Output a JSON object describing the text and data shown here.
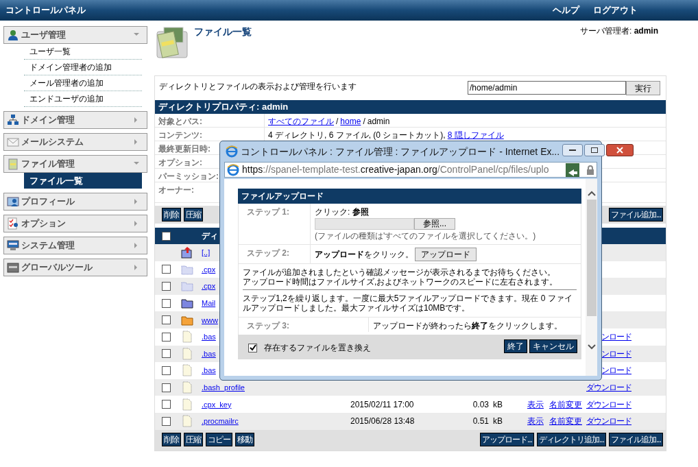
{
  "topbar": {
    "title": "コントロールパネル",
    "links": [
      "ヘルプ",
      "ログアウト"
    ]
  },
  "sidebar": [
    {
      "label": "ユーザ管理",
      "expanded": true,
      "children": [
        {
          "label": "ユーザ一覧",
          "selected": false
        },
        {
          "label": "ドメイン管理者の追加",
          "selected": false
        },
        {
          "label": "メール管理者の追加",
          "selected": false
        },
        {
          "label": "エンドユーザの追加",
          "selected": false
        }
      ]
    },
    {
      "label": "ドメイン管理",
      "expanded": false
    },
    {
      "label": "メールシステム",
      "expanded": false
    },
    {
      "label": "ファイル管理",
      "expanded": true,
      "children": [
        {
          "label": "ファイル一覧",
          "selected": true
        }
      ]
    },
    {
      "label": "プロフィール",
      "expanded": false
    },
    {
      "label": "オプション",
      "expanded": false
    },
    {
      "label": "システム管理",
      "expanded": false
    },
    {
      "label": "グローバルツール",
      "expanded": false
    }
  ],
  "page": {
    "title": "ファイル一覧",
    "user": "サーバ管理者: **admin**",
    "description": "ディレクトリとファイルの表示および管理を行います",
    "path_value": "/home/admin",
    "go_button": "実行"
  },
  "properties": {
    "title": "ディレクトリプロパティ: admin",
    "rows": [
      {
        "label": "対象とパス:",
        "links": [
          "すべてのファイル",
          "home"
        ],
        "separator": "/",
        "current": "admin"
      },
      {
        "label": "コンテンツ:",
        "text": "4 ディレクトリ, 6 ファイル, (0 ショートカット),",
        "link": "8 隠しファイル"
      },
      {
        "label": "最終更新日時:"
      },
      {
        "label": "オプション:"
      },
      {
        "label": "パーミッション:"
      },
      {
        "label": "オーナー:"
      }
    ]
  },
  "toolbar_top": {
    "left": [
      "削除",
      "圧縮"
    ],
    "right": [
      "ファイル追加..."
    ]
  },
  "table": {
    "header_checked": false,
    "column_2": "ディ",
    "rows": [
      {
        "kind": "up",
        "name": "[..]"
      },
      {
        "kind": "hidden_folder",
        "checked": false,
        "name": ".cpx"
      },
      {
        "kind": "hidden_folder",
        "checked": false,
        "name": ".cpx"
      },
      {
        "kind": "folder",
        "checked": false,
        "name": "Mail"
      },
      {
        "kind": "web_folder",
        "checked": false,
        "name": "www"
      },
      {
        "kind": "file",
        "checked": false,
        "name": ".bas",
        "download": "ンロード"
      },
      {
        "kind": "file",
        "checked": false,
        "name": ".bas",
        "download": "ンロード"
      },
      {
        "kind": "file",
        "checked": false,
        "name": ".bas",
        "download": "ンロード"
      },
      {
        "kind": "file",
        "checked": false,
        "name": ".bash_profile",
        "download": "ダウンロード"
      },
      {
        "kind": "file",
        "checked": false,
        "name": ".cpx_key",
        "date": "2015/02/11 17:00",
        "size": "0.03",
        "unit": "kB",
        "view": "表示",
        "rename": "名前変更",
        "download": "ダウンロード"
      },
      {
        "kind": "file",
        "checked": false,
        "name": ".procmailrc",
        "date": "2015/06/28 13:48",
        "size": "0.51",
        "unit": "kB",
        "view": "表示",
        "rename": "名前変更",
        "download": "ダウンロード"
      }
    ]
  },
  "toolbar_bottom": {
    "left": [
      "削除",
      "圧縮",
      "コピー",
      "移動"
    ],
    "right": [
      "アップロード...",
      "ディレクトリ追加...",
      "ファイル追加..."
    ]
  },
  "popup": {
    "title": "コントロールパネル : ファイル管理 : ファイルアップロード - Internet Ex...",
    "url": [
      {
        "text": "https",
        "strong": true
      },
      {
        "text": "://spanel-template-test.",
        "strong": false
      },
      {
        "text": "creative-japan.org",
        "strong": true
      },
      {
        "text": "/ControlPanel/cp/files/uplo",
        "strong": false
      }
    ],
    "form_title": "ファイルアップロード",
    "step1": {
      "label": "ステップ 1:",
      "instruction": "クリック: **参照**",
      "browse_button": "参照...",
      "hint": "(ファイルの種類は'すべてのファイルを選択してください。)"
    },
    "step2": {
      "label": "ステップ 2:",
      "instruction": "**アップロード**をクリック。",
      "button": "アップロード"
    },
    "notice": [
      "ファイルが追加されましたという確認メッセージが表示されるまでお待ちください。",
      "アップロード時間はファイルサイズ,およびネットワークのスピードに左右されます。"
    ],
    "repeat": "ステップ1,2を繰り返します。一度に最大5ファイルアップロードできます。現在 0 ファイルアップロードしました。最大ファイルサイズは10MBです。",
    "step3": {
      "label": "ステップ 3:",
      "text": "アップロードが終わったら**終了**をクリックします。"
    },
    "replace": {
      "label": "存在するファイルを置き換え",
      "checked": true
    },
    "buttons": [
      "終了",
      "キャンセル"
    ]
  }
}
